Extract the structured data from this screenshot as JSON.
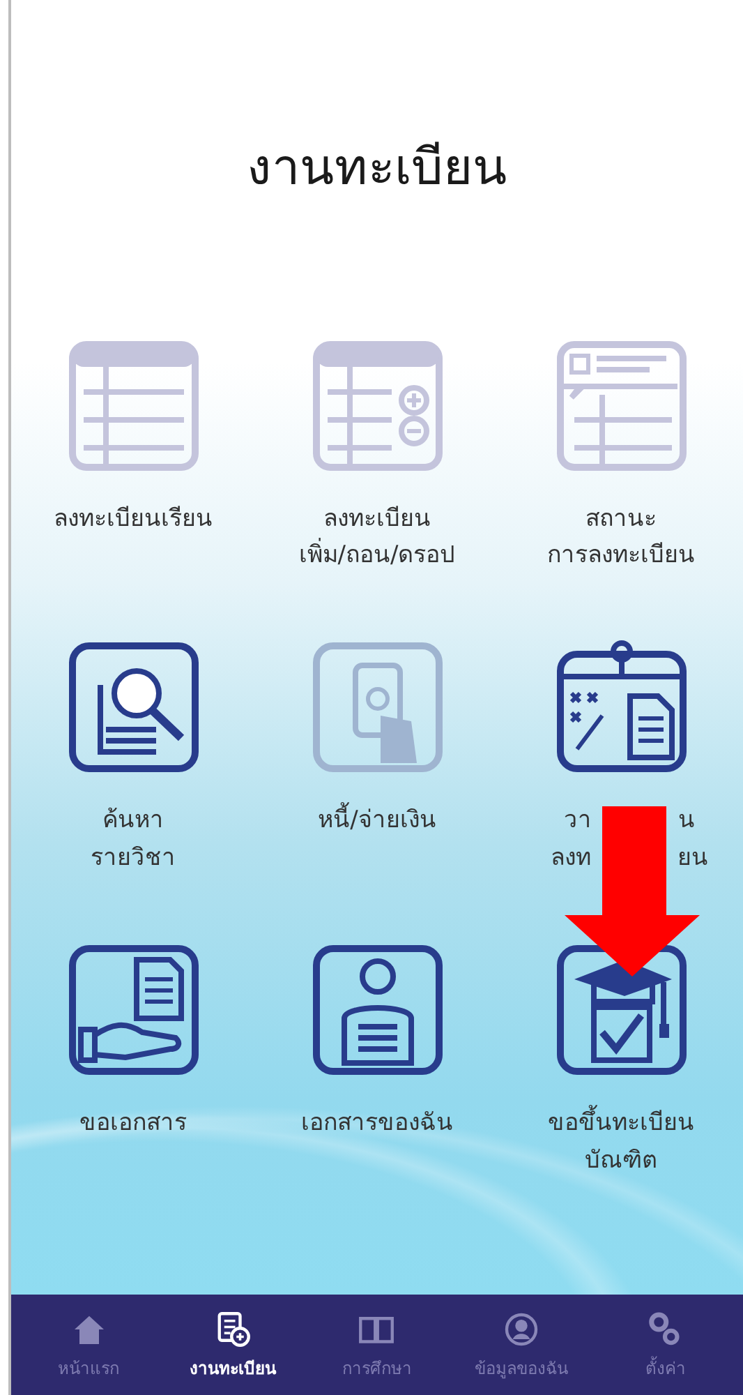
{
  "title": "งานทะเบียน",
  "menu_items": [
    {
      "label": "ลงทะเบียนเรียน",
      "disabled": true
    },
    {
      "label": "ลงทะเบียน\nเพิ่ม/ถอน/ดรอป",
      "disabled": true
    },
    {
      "label": "สถานะ\nการลงทะเบียน",
      "disabled": true
    },
    {
      "label": "ค้นหา\nรายวิชา",
      "disabled": false
    },
    {
      "label": "หนี้/จ่ายเงิน",
      "disabled": true
    },
    {
      "label_fragments": [
        [
          "วา",
          "น"
        ],
        [
          "ลงท",
          "ยน"
        ]
      ],
      "disabled": false
    },
    {
      "label": "ขอเอกสาร",
      "disabled": false
    },
    {
      "label": "เอกสารของฉัน",
      "disabled": false
    },
    {
      "label": "ขอขึ้นทะเบียน\nบัณฑิต",
      "disabled": false
    }
  ],
  "bottom_nav": [
    {
      "label": "หน้าแรก",
      "selected": false
    },
    {
      "label": "งานทะเบียน",
      "selected": true
    },
    {
      "label": "การศึกษา",
      "selected": false
    },
    {
      "label": "ข้อมูลของฉัน",
      "selected": false
    },
    {
      "label": "ตั้งค่า",
      "selected": false
    }
  ]
}
